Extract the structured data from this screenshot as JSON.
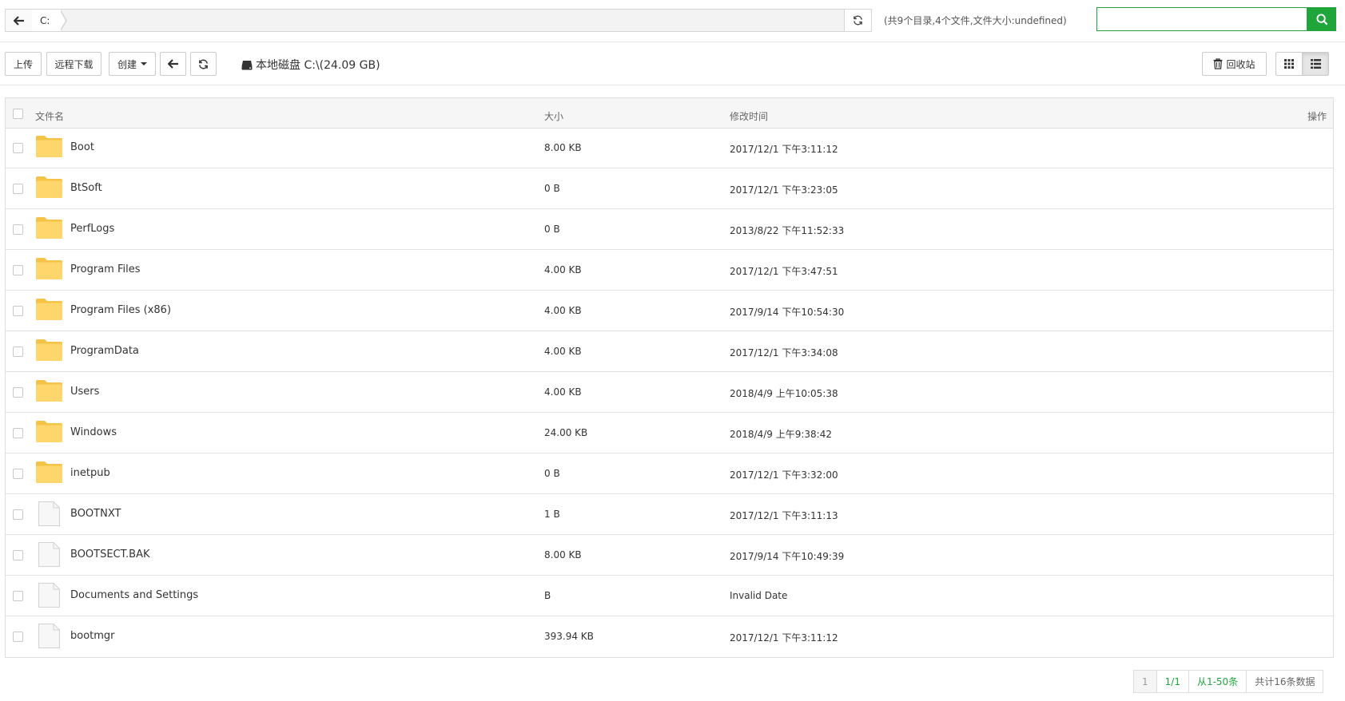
{
  "pathbar": {
    "crumb": "C:"
  },
  "summary": "(共9个目录,4个文件,文件大小:undefined)",
  "search": {
    "value": "",
    "placeholder": ""
  },
  "toolbar": {
    "upload": "上传",
    "remote_download": "远程下载",
    "create": "创建",
    "disk_label": "本地磁盘 C:\\(24.09 GB)",
    "recycle_bin": "回收站"
  },
  "table": {
    "columns": {
      "name": "文件名",
      "size": "大小",
      "mtime": "修改时间",
      "actions": "操作"
    },
    "rows": [
      {
        "type": "folder",
        "name": "Boot",
        "size": "8.00 KB",
        "mtime": "2017/12/1 下午3:11:12"
      },
      {
        "type": "folder",
        "name": "BtSoft",
        "size": "0 B",
        "mtime": "2017/12/1 下午3:23:05"
      },
      {
        "type": "folder",
        "name": "PerfLogs",
        "size": "0 B",
        "mtime": "2013/8/22 下午11:52:33"
      },
      {
        "type": "folder",
        "name": "Program Files",
        "size": "4.00 KB",
        "mtime": "2017/12/1 下午3:47:51"
      },
      {
        "type": "folder",
        "name": "Program Files (x86)",
        "size": "4.00 KB",
        "mtime": "2017/9/14 下午10:54:30"
      },
      {
        "type": "folder",
        "name": "ProgramData",
        "size": "4.00 KB",
        "mtime": "2017/12/1 下午3:34:08"
      },
      {
        "type": "folder",
        "name": "Users",
        "size": "4.00 KB",
        "mtime": "2018/4/9 上午10:05:38"
      },
      {
        "type": "folder",
        "name": "Windows",
        "size": "24.00 KB",
        "mtime": "2018/4/9 上午9:38:42"
      },
      {
        "type": "folder",
        "name": "inetpub",
        "size": "0 B",
        "mtime": "2017/12/1 下午3:32:00"
      },
      {
        "type": "file",
        "name": "BOOTNXT",
        "size": "1 B",
        "mtime": "2017/12/1 下午3:11:13"
      },
      {
        "type": "file",
        "name": "BOOTSECT.BAK",
        "size": "8.00 KB",
        "mtime": "2017/9/14 下午10:49:39"
      },
      {
        "type": "file",
        "name": "Documents and Settings",
        "size": "B",
        "mtime": "Invalid Date"
      },
      {
        "type": "file",
        "name": "bootmgr",
        "size": "393.94 KB",
        "mtime": "2017/12/1 下午3:11:12"
      }
    ]
  },
  "pager": {
    "page": "1",
    "total_pages": "1/1",
    "range": "从1-50条",
    "total": "共计16条数据"
  },
  "colors": {
    "accent": "#20a53a",
    "folder": "#ffd66b",
    "folder_dark": "#f5c345"
  },
  "icons": [
    "back-arrow-icon",
    "refresh-icon",
    "search-icon",
    "hdd-icon",
    "trash-icon",
    "grid-view-icon",
    "list-view-icon",
    "folder-icon",
    "file-icon"
  ]
}
